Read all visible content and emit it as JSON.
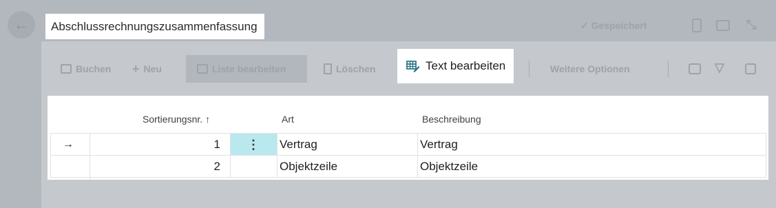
{
  "header": {
    "back_icon": "back-arrow-icon",
    "title": "Abschlussrechnungszusammenfassung",
    "saved_label": "✓ Gespeichert",
    "header_icons": [
      "bookmark-icon",
      "open-in-new-icon",
      "collapse-icon"
    ]
  },
  "toolbar": {
    "items": [
      {
        "label": "Buchen",
        "icon": "post-icon"
      },
      {
        "label": "Neu",
        "icon": "plus-icon"
      },
      {
        "label": "Liste bearbeiten",
        "icon": "edit-list-icon"
      },
      {
        "label": "Löschen",
        "icon": "delete-icon"
      }
    ],
    "highlighted": {
      "label": "Text bearbeiten",
      "icon": "edit-text-table-icon",
      "icon_color": "#1a6b7e"
    },
    "more_label": "Weitere Optionen",
    "right_icons": [
      "share-icon",
      "filter-icon",
      "list-view-icon"
    ]
  },
  "table": {
    "columns": {
      "sort_no": "Sortierungsnr.",
      "sort_indicator": "↑",
      "type": "Art",
      "description": "Beschreibung"
    },
    "rows": [
      {
        "selected": true,
        "indicator": "→",
        "sort_no": "1",
        "menu": "⋮",
        "type": "Vertrag",
        "description": "Vertrag"
      },
      {
        "selected": false,
        "indicator": "",
        "sort_no": "2",
        "menu": "",
        "type": "Objektzeile",
        "description": "Objektzeile"
      }
    ]
  },
  "colors": {
    "overlay": "#b3b7be",
    "selected_cell": "#b9e8ef",
    "accent": "#1a6b7e"
  }
}
